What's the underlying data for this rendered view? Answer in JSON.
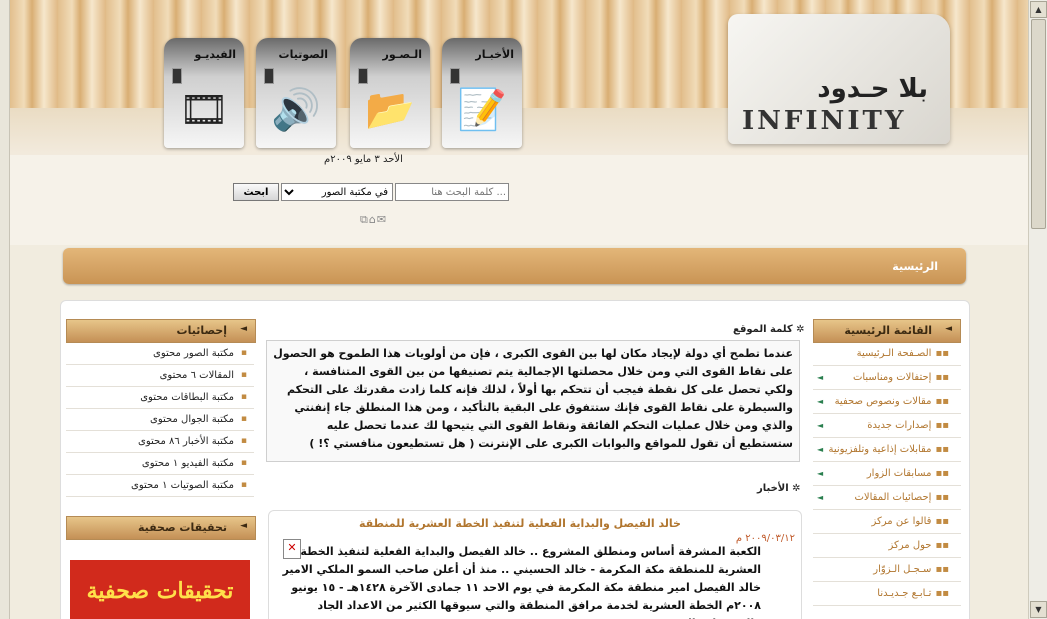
{
  "header": {
    "logo_ar": "بلا حـدود",
    "logo_en": "INFINITY",
    "tabs": [
      {
        "label": "الفيديـو",
        "icon": "film-reel-icon"
      },
      {
        "label": "الصوتيات",
        "icon": "speaker-icon"
      },
      {
        "label": "الـصـور",
        "icon": "photo-folder-icon"
      },
      {
        "label": "الأخبـار",
        "icon": "notepad-pencil-icon"
      }
    ],
    "date": "الأحد ٣ مايو ٢٠٠٩م",
    "search": {
      "placeholder": "... كلمة البحث هنا",
      "select_value": "في مكتبة الصور",
      "button_label": "ابحث"
    },
    "small_icons": "sitemap-icon home-icon mail-icon"
  },
  "navbar": {
    "home_label": "الرئيسية"
  },
  "left_sidebar": {
    "stats_title": "إحصائيات",
    "stats": [
      "مكتبة الصور محتوى",
      "المقالات ٦ محتوى",
      "مكتبة البطاقات محتوى",
      "مكتبة الجوال محتوى",
      "مكتبة الأخبار ٨٦ محتوى",
      "مكتبة الفيديو ١ محتوى",
      "مكتبة الصوتيات ١ محتوى"
    ],
    "reports_title": "تحقيقات صحفية",
    "reports_banner": "تحقيقات صحفية"
  },
  "right_sidebar": {
    "title": "القائمة الرئيسية",
    "items": [
      {
        "label": "الصـفحة الـرئيسية",
        "expandable": false
      },
      {
        "label": "إحتفالات ومناسبات",
        "expandable": true
      },
      {
        "label": "مقالات ونصوص صحفية",
        "expandable": true
      },
      {
        "label": "إصدارات جديدة",
        "expandable": true
      },
      {
        "label": "مقابلات إذاعية وتلفزيونية",
        "expandable": true
      },
      {
        "label": "مسابقات الزوار",
        "expandable": true
      },
      {
        "label": "إحصائيات المقالات",
        "expandable": true
      },
      {
        "label": "قالوا عن مركز",
        "expandable": false
      },
      {
        "label": "حول مركز",
        "expandable": false
      },
      {
        "label": "سـجـل الـزوّار",
        "expandable": false
      },
      {
        "label": "تـابـع جـديـدنا",
        "expandable": false
      }
    ]
  },
  "main": {
    "welcome_title": "كلمة الموقع",
    "welcome_text": "عندما تطمح أي دولة لإيجاد مكان لها بين القوى الكبرى ، فإن من أولويات هذا الطموح هو الحصول على نقاط القوى التي ومن خلال محصلتها الإجمالية يتم تصنيفها من بين القوى المتنافسة ، ولكي تحصل على كل نقطة فيجب أن تتحكم بها أولاً ، لذلك فإنه كلما زادت مقدرتك على التحكم والسيطرة على نقاط القوى فإنك ستتفوق على البقية بالتأكيد ، ومن هذا المنطلق جاء إنفنتي والذي ومن خلال عمليات التحكم الفائقة ونقاط القوى التي يتيحها لك عندما تحصل عليه ستستطيع أن تقول للمواقع والبوابات الكبرى على الإنترنت ( هل تستطيعون منافستي ؟! )",
    "news_title": "الأخبار",
    "news": {
      "headline": "خالد الفيصل والبداية الفعلية لتنفيذ الخطة العشرية للمنطقة",
      "date": "٢٠٠٩/٠٣/١٢ م",
      "body": "الكعبة المشرفة أساس ومنطلق المشروع .. خالد الفيصل والبداية الفعلية لتنفيذ الخطة العشرية للمنطقة مكة المكرمة - خالد الحسيني .. منذ أن أعلن صاحب السمو الملكي الامير خالد الفيصل امير منطقة مكة المكرمة في يوم الاحد ١١ جمادى الآخرة ١٤٢٨هـ - ١٥ يونيو ٢٠٠٨م الخطة العشرية لخدمة مرافق المنطقة والتي سيوقها الكثير من الاعداد الجاد والمشترك والمتنوع من عدد من"
    }
  },
  "colors": {
    "accent": "#c99454",
    "link": "#b1762f",
    "date": "#c05a2a"
  }
}
